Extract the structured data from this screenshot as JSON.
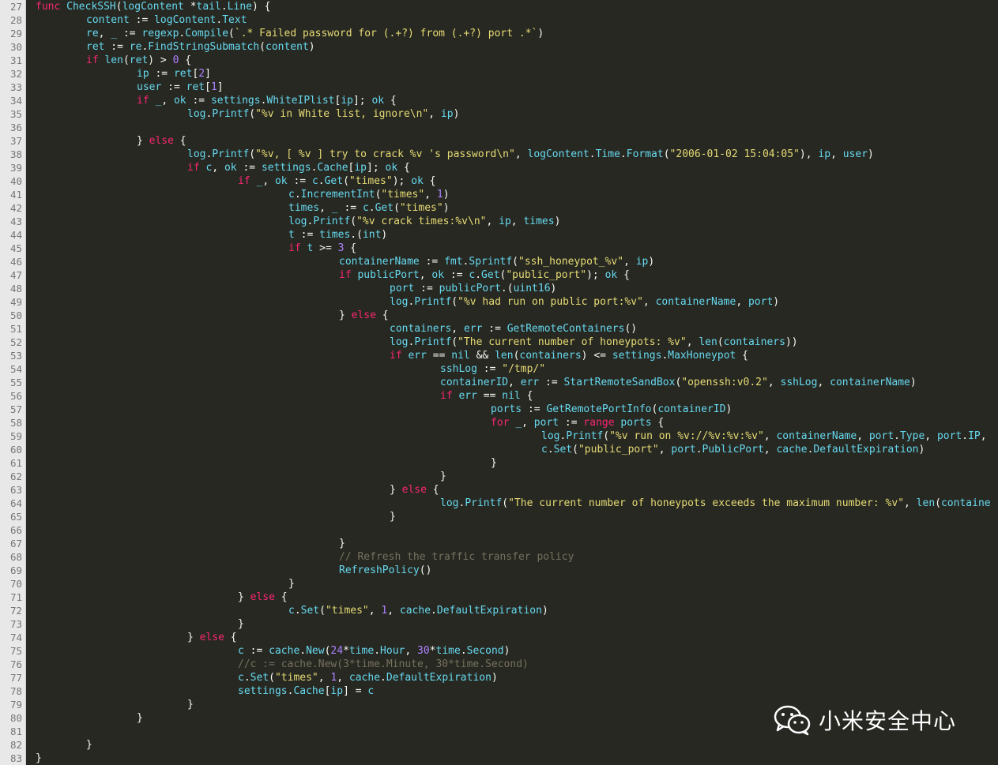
{
  "editor": {
    "language": "go",
    "colors": {
      "background": "#272822",
      "gutter": "#e8e8e8",
      "keyword": "#f92672",
      "identifier": "#66d9ef",
      "string": "#e6db74",
      "number": "#ae81ff",
      "comment": "#75715e"
    },
    "lines": [
      {
        "n": "27",
        "indent": 0,
        "text": "func CheckSSH(logContent *tail.Line) {"
      },
      {
        "n": "28",
        "indent": 1,
        "text": "content := logContent.Text"
      },
      {
        "n": "29",
        "indent": 1,
        "text": "re, _ := regexp.Compile(`.* Failed password for (.+?) from (.+?) port .*`)"
      },
      {
        "n": "30",
        "indent": 1,
        "text": "ret := re.FindStringSubmatch(content)"
      },
      {
        "n": "31",
        "indent": 1,
        "text": "if len(ret) > 0 {"
      },
      {
        "n": "32",
        "indent": 2,
        "text": "ip := ret[2]"
      },
      {
        "n": "33",
        "indent": 2,
        "text": "user := ret[1]"
      },
      {
        "n": "34",
        "indent": 2,
        "text": "if _, ok := settings.WhiteIPlist[ip]; ok {"
      },
      {
        "n": "35",
        "indent": 3,
        "text": "log.Printf(\"%v in White list, ignore\\n\", ip)"
      },
      {
        "n": "36",
        "indent": 0,
        "text": ""
      },
      {
        "n": "37",
        "indent": 2,
        "text": "} else {"
      },
      {
        "n": "38",
        "indent": 3,
        "text": "log.Printf(\"%v, [ %v ] try to crack %v 's password\\n\", logContent.Time.Format(\"2006-01-02 15:04:05\"), ip, user)"
      },
      {
        "n": "39",
        "indent": 3,
        "text": "if c, ok := settings.Cache[ip]; ok {"
      },
      {
        "n": "40",
        "indent": 4,
        "text": "if _, ok := c.Get(\"times\"); ok {"
      },
      {
        "n": "41",
        "indent": 5,
        "text": "c.IncrementInt(\"times\", 1)"
      },
      {
        "n": "42",
        "indent": 5,
        "text": "times, _ := c.Get(\"times\")"
      },
      {
        "n": "43",
        "indent": 5,
        "text": "log.Printf(\"%v crack times:%v\\n\", ip, times)"
      },
      {
        "n": "44",
        "indent": 5,
        "text": "t := times.(int)"
      },
      {
        "n": "45",
        "indent": 5,
        "text": "if t >= 3 {"
      },
      {
        "n": "46",
        "indent": 6,
        "text": "containerName := fmt.Sprintf(\"ssh_honeypot_%v\", ip)"
      },
      {
        "n": "47",
        "indent": 6,
        "text": "if publicPort, ok := c.Get(\"public_port\"); ok {"
      },
      {
        "n": "48",
        "indent": 7,
        "text": "port := publicPort.(uint16)"
      },
      {
        "n": "49",
        "indent": 7,
        "text": "log.Printf(\"%v had run on public port:%v\", containerName, port)"
      },
      {
        "n": "50",
        "indent": 6,
        "text": "} else {"
      },
      {
        "n": "51",
        "indent": 7,
        "text": "containers, err := GetRemoteContainers()"
      },
      {
        "n": "52",
        "indent": 7,
        "text": "log.Printf(\"The current number of honeypots: %v\", len(containers))"
      },
      {
        "n": "53",
        "indent": 7,
        "text": "if err == nil && len(containers) <= settings.MaxHoneypot {"
      },
      {
        "n": "54",
        "indent": 8,
        "text": "sshLog := \"/tmp/\""
      },
      {
        "n": "55",
        "indent": 8,
        "text": "containerID, err := StartRemoteSandBox(\"openssh:v0.2\", sshLog, containerName)"
      },
      {
        "n": "56",
        "indent": 8,
        "text": "if err == nil {"
      },
      {
        "n": "57",
        "indent": 9,
        "text": "ports := GetRemotePortInfo(containerID)"
      },
      {
        "n": "58",
        "indent": 9,
        "text": "for _, port := range ports {"
      },
      {
        "n": "59",
        "indent": 10,
        "text": "log.Printf(\"%v run on %v://%v:%v:%v\", containerName, port.Type, port.IP,"
      },
      {
        "n": "60",
        "indent": 10,
        "text": "c.Set(\"public_port\", port.PublicPort, cache.DefaultExpiration)"
      },
      {
        "n": "61",
        "indent": 9,
        "text": "}"
      },
      {
        "n": "62",
        "indent": 8,
        "text": "}"
      },
      {
        "n": "63",
        "indent": 7,
        "text": "} else {"
      },
      {
        "n": "64",
        "indent": 8,
        "text": "log.Printf(\"The current number of honeypots exceeds the maximum number: %v\", len(containe"
      },
      {
        "n": "65",
        "indent": 7,
        "text": "}"
      },
      {
        "n": "66",
        "indent": 0,
        "text": ""
      },
      {
        "n": "67",
        "indent": 6,
        "text": "}"
      },
      {
        "n": "68",
        "indent": 6,
        "text": "// Refresh the traffic transfer policy"
      },
      {
        "n": "69",
        "indent": 6,
        "text": "RefreshPolicy()"
      },
      {
        "n": "70",
        "indent": 5,
        "text": "}"
      },
      {
        "n": "71",
        "indent": 4,
        "text": "} else {"
      },
      {
        "n": "72",
        "indent": 5,
        "text": "c.Set(\"times\", 1, cache.DefaultExpiration)"
      },
      {
        "n": "73",
        "indent": 4,
        "text": "}"
      },
      {
        "n": "74",
        "indent": 3,
        "text": "} else {"
      },
      {
        "n": "75",
        "indent": 4,
        "text": "c := cache.New(24*time.Hour, 30*time.Second)"
      },
      {
        "n": "76",
        "indent": 4,
        "text": "//c := cache.New(3*time.Minute, 30*time.Second)"
      },
      {
        "n": "77",
        "indent": 4,
        "text": "c.Set(\"times\", 1, cache.DefaultExpiration)"
      },
      {
        "n": "78",
        "indent": 4,
        "text": "settings.Cache[ip] = c"
      },
      {
        "n": "79",
        "indent": 3,
        "text": "}"
      },
      {
        "n": "80",
        "indent": 2,
        "text": "}"
      },
      {
        "n": "81",
        "indent": 0,
        "text": ""
      },
      {
        "n": "82",
        "indent": 1,
        "text": "}"
      },
      {
        "n": "83",
        "indent": 0,
        "text": "}"
      }
    ]
  },
  "watermark": {
    "icon": "wechat-icon",
    "text": "小米安全中心"
  }
}
